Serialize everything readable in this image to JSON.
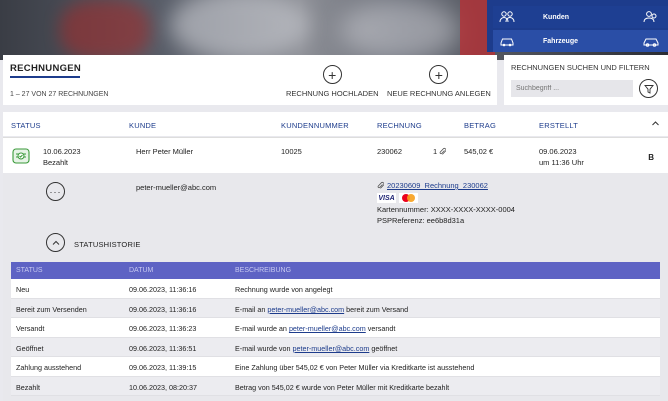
{
  "nav": {
    "items": [
      {
        "label": "Kunden",
        "icon": "users-icon"
      },
      {
        "label": "Fahrzeuge",
        "icon": "car-icon"
      }
    ]
  },
  "invoices": {
    "title": "RECHNUNGEN",
    "count": "1 – 27 VON 27 RECHNUNGEN",
    "upload_label": "RECHNUNG HOCHLADEN",
    "create_label": "NEUE RECHNUNG ANLEGEN"
  },
  "search": {
    "title": "RECHNUNGEN SUCHEN UND FILTERN",
    "placeholder": "Suchbegriff ..."
  },
  "columns": {
    "status": "STATUS",
    "kunde": "KUNDE",
    "kundennummer": "KUNDENNUMMER",
    "rechnung": "RECHNUNG",
    "betrag": "BETRAG",
    "erstellt": "ERSTELLT"
  },
  "row": {
    "date": "10.06.2023",
    "status": "Bezahlt",
    "customer": "Herr Peter Müller",
    "customer_number": "10025",
    "invoice": "230062",
    "attachments": "1",
    "amount": "545,02 €",
    "created_date": "09.06.2023",
    "created_time": "um 11:36 Uhr",
    "badge": "B"
  },
  "details": {
    "email": "peter-mueller@abc.com",
    "file": "20230609_Rechnung_230062",
    "card_number": "Kartennummer: XXXX-XXXX-XXXX-0004",
    "psp_ref": "PSPReferenz: ee6b8d31a",
    "visa": "VISA"
  },
  "history": {
    "title": "STATUSHISTORIE",
    "headers": {
      "status": "STATUS",
      "datum": "DATUM",
      "beschreibung": "BESCHREIBUNG"
    },
    "rows": [
      {
        "status": "Neu",
        "date": "09.06.2023, 11:36:16",
        "pre": "Rechnung wurde von angelegt",
        "link": "",
        "post": ""
      },
      {
        "status": "Bereit zum Versenden",
        "date": "09.06.2023, 11:36:16",
        "pre": "E-mail an ",
        "link": "peter-mueller@abc.com",
        "post": " bereit zum Versand"
      },
      {
        "status": "Versandt",
        "date": "09.06.2023, 11:36:23",
        "pre": "E-mail wurde an ",
        "link": "peter-mueller@abc.com",
        "post": " versandt"
      },
      {
        "status": "Geöffnet",
        "date": "09.06.2023, 11:36:51",
        "pre": "E-mail wurde von ",
        "link": "peter-mueller@abc.com",
        "post": " geöffnet"
      },
      {
        "status": "Zahlung ausstehend",
        "date": "09.06.2023, 11:39:15",
        "pre": "Eine Zahlung über 545,02 € von Peter Müller via Kreditkarte ist ausstehend",
        "link": "",
        "post": ""
      },
      {
        "status": "Bezahlt",
        "date": "10.06.2023, 08:20:37",
        "pre": "Betrag von 545,02 € wurde von Peter Müller mit Kreditkarte bezahlt",
        "link": "",
        "post": ""
      }
    ]
  },
  "colors": {
    "accent": "#1d3c8c",
    "table_header": "#5e63c4",
    "status_green": "#3a9a3a"
  }
}
